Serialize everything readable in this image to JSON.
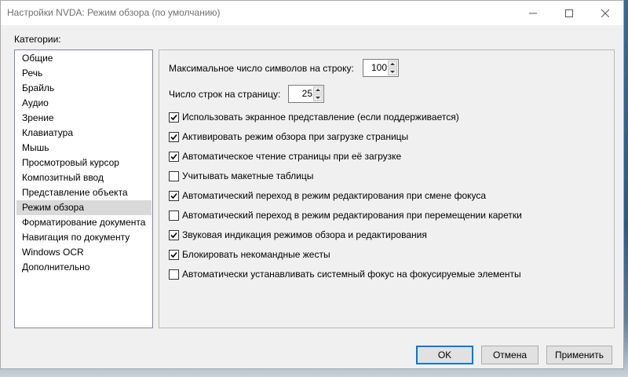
{
  "window": {
    "title": "Настройки NVDA: Режим обзора (по умолчанию)"
  },
  "titlebar_icons": [
    "minimize-icon",
    "maximize-icon",
    "close-icon"
  ],
  "sidebar": {
    "label": "Категории:",
    "items": [
      {
        "label": "Общие",
        "selected": false
      },
      {
        "label": "Речь",
        "selected": false
      },
      {
        "label": "Брайль",
        "selected": false
      },
      {
        "label": "Аудио",
        "selected": false
      },
      {
        "label": "Зрение",
        "selected": false
      },
      {
        "label": "Клавиатура",
        "selected": false
      },
      {
        "label": "Мышь",
        "selected": false
      },
      {
        "label": "Просмотровый курсор",
        "selected": false
      },
      {
        "label": "Композитный ввод",
        "selected": false
      },
      {
        "label": "Представление объекта",
        "selected": false
      },
      {
        "label": "Режим обзора",
        "selected": true
      },
      {
        "label": "Форматирование документа",
        "selected": false
      },
      {
        "label": "Навигация по документу",
        "selected": false
      },
      {
        "label": "Windows OCR",
        "selected": false
      },
      {
        "label": "Дополнительно",
        "selected": false
      }
    ]
  },
  "settings": {
    "max_chars": {
      "label": "Максимальное число символов на строку:",
      "value": "100"
    },
    "lines_per_page": {
      "label": "Число строк на страницу:",
      "value": "25"
    },
    "checkboxes": [
      {
        "label": "Использовать экранное представление (если поддерживается)",
        "checked": true
      },
      {
        "label": "Активировать режим обзора при загрузке страницы",
        "checked": true
      },
      {
        "label": "Автоматическое чтение страницы при её загрузке",
        "checked": true
      },
      {
        "label": "Учитывать макетные таблицы",
        "checked": false
      },
      {
        "label": "Автоматический переход в режим редактирования при смене фокуса",
        "checked": true
      },
      {
        "label": "Автоматический переход в режим редактирования при перемещении каретки",
        "checked": false
      },
      {
        "label": "Звуковая индикация режимов обзора и редактирования",
        "checked": true
      },
      {
        "label": "Блокировать некомандные жесты",
        "checked": true
      },
      {
        "label": "Автоматически устанавливать системный фокус на фокусируемые элементы",
        "checked": false
      }
    ]
  },
  "buttons": {
    "ok": "OK",
    "cancel": "Отмена",
    "apply": "Применить"
  },
  "colors": {
    "window_bg": "#f0f0f0",
    "selected_item_bg": "#d9d9d9",
    "default_button_border": "#0078d7"
  }
}
